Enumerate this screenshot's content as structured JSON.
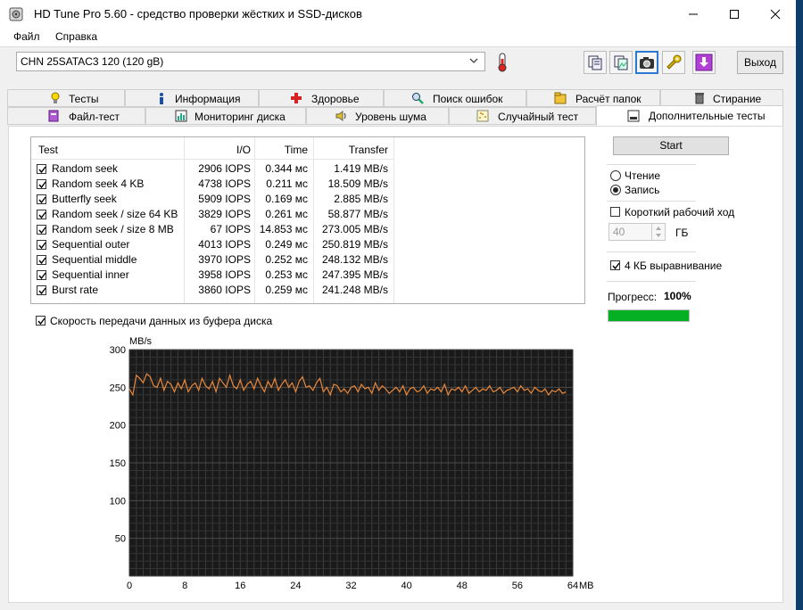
{
  "window": {
    "title": "HD Tune Pro 5.60 - средство проверки жёстких и SSD-дисков",
    "minimize_label": "—",
    "maximize_label": "☐",
    "close_label": "✕"
  },
  "menu": {
    "items": [
      "Файл",
      "Справка"
    ]
  },
  "toolbar": {
    "drive": "CHN 25SATAC3 120 (120 gB)",
    "exit_label": "Выход",
    "icons": [
      "thermometer-icon",
      "copy-text-icon",
      "copy-image-icon",
      "camera-icon",
      "tools-icon",
      "download-icon"
    ]
  },
  "tabs": {
    "row1": [
      "Тесты",
      "Информация",
      "Здоровье",
      "Поиск ошибок",
      "Расчёт папок",
      "Стирание"
    ],
    "row2": [
      "Файл-тест",
      "Мониторинг диска",
      "Уровень шума",
      "Случайный тест",
      "Дополнительные тесты"
    ],
    "active": "Дополнительные тесты"
  },
  "table": {
    "headers": {
      "test": "Test",
      "io": "I/O",
      "time": "Time",
      "transfer": "Transfer"
    },
    "rows": [
      {
        "test": "Random seek",
        "io": "2906 IOPS",
        "time": "0.344 мс",
        "transfer": "1.419 MB/s"
      },
      {
        "test": "Random seek 4 KB",
        "io": "4738 IOPS",
        "time": "0.211 мс",
        "transfer": "18.509 MB/s"
      },
      {
        "test": "Butterfly seek",
        "io": "5909 IOPS",
        "time": "0.169 мс",
        "transfer": "2.885 MB/s"
      },
      {
        "test": "Random seek  / size 64 KB",
        "io": "3829 IOPS",
        "time": "0.261 мс",
        "transfer": "58.877 MB/s"
      },
      {
        "test": "Random seek  / size 8 MB",
        "io": "67 IOPS",
        "time": "14.853 мс",
        "transfer": "273.005 MB/s"
      },
      {
        "test": "Sequential outer",
        "io": "4013 IOPS",
        "time": "0.249 мс",
        "transfer": "250.819 MB/s"
      },
      {
        "test": "Sequential middle",
        "io": "3970 IOPS",
        "time": "0.252 мс",
        "transfer": "248.132 MB/s"
      },
      {
        "test": "Sequential inner",
        "io": "3958 IOPS",
        "time": "0.253 мс",
        "transfer": "247.395 MB/s"
      },
      {
        "test": "Burst rate",
        "io": "3860 IOPS",
        "time": "0.259 мс",
        "transfer": "241.248 MB/s"
      }
    ]
  },
  "buffer_checkbox_label": "Скорость передачи данных из буфера диска",
  "side": {
    "start_label": "Start",
    "read_label": "Чтение",
    "write_label": "Запись",
    "selected_mode": "Запись",
    "short_stroke_label": "Короткий рабочий ход",
    "short_stroke_value": "40",
    "gb_label": "ГБ",
    "align_label": "4 КБ выравнивание",
    "progress_label": "Прогресс:",
    "progress_value": "100%",
    "progress_fraction": 1.0,
    "progress_color": "#06b025"
  },
  "chart_data": {
    "type": "line",
    "ylabel": "MB/s",
    "xlabel": "",
    "x_unit_label": "MB",
    "ylim": [
      0,
      300
    ],
    "xlim": [
      0,
      64
    ],
    "y_ticks": [
      50,
      100,
      150,
      200,
      250,
      300
    ],
    "x_ticks": [
      0,
      8,
      16,
      24,
      32,
      40,
      48,
      56,
      64
    ],
    "grid": true,
    "background": "#1a1a1a",
    "line_color": "#e8873a",
    "series": [
      {
        "name": "",
        "x": [
          0,
          0.5,
          1,
          1.5,
          2,
          2.5,
          3,
          3.5,
          4,
          4.5,
          5,
          5.5,
          6,
          6.5,
          7,
          7.5,
          8,
          8.5,
          9,
          9.5,
          10,
          10.5,
          11,
          11.5,
          12,
          12.5,
          13,
          13.5,
          14,
          14.5,
          15,
          15.5,
          16,
          16.5,
          17,
          17.5,
          18,
          18.5,
          19,
          19.5,
          20,
          20.5,
          21,
          21.5,
          22,
          22.5,
          23,
          23.5,
          24,
          24.5,
          25,
          25.5,
          26,
          26.5,
          27,
          27.5,
          28,
          28.5,
          29,
          29.5,
          30,
          30.5,
          31,
          31.5,
          32,
          32.5,
          33,
          33.5,
          34,
          34.5,
          35,
          35.5,
          36,
          36.5,
          37,
          37.5,
          38,
          38.5,
          39,
          39.5,
          40,
          40.5,
          41,
          41.5,
          42,
          42.5,
          43,
          43.5,
          44,
          44.5,
          45,
          45.5,
          46,
          46.5,
          47,
          47.5,
          48,
          48.5,
          49,
          49.5,
          50,
          50.5,
          51,
          51.5,
          52,
          52.5,
          53,
          53.5,
          54,
          54.5,
          55,
          55.5,
          56,
          56.5,
          57,
          57.5,
          58,
          58.5,
          59,
          59.5,
          60,
          60.5,
          61,
          61.5,
          62,
          62.5,
          63
        ],
        "values": [
          248,
          240,
          266,
          262,
          256,
          268,
          264,
          252,
          250,
          262,
          246,
          258,
          254,
          244,
          256,
          248,
          260,
          244,
          252,
          256,
          246,
          262,
          252,
          248,
          258,
          244,
          262,
          256,
          250,
          266,
          252,
          248,
          260,
          246,
          254,
          258,
          248,
          262,
          252,
          244,
          258,
          250,
          262,
          246,
          254,
          260,
          250,
          256,
          244,
          258,
          264,
          250,
          252,
          246,
          256,
          262,
          244,
          250,
          240,
          254,
          252,
          244,
          248,
          242,
          250,
          252,
          244,
          254,
          248,
          250,
          242,
          256,
          246,
          252,
          248,
          242,
          246,
          250,
          244,
          252,
          240,
          248,
          250,
          244,
          246,
          252,
          242,
          248,
          246,
          250,
          244,
          254,
          240,
          248,
          246,
          250,
          244,
          252,
          242,
          246,
          250,
          244,
          248,
          246,
          252,
          244,
          246,
          250,
          242,
          246,
          248,
          250,
          244,
          252,
          246,
          248,
          242,
          250,
          246,
          244,
          248,
          240,
          246,
          244,
          248,
          242,
          244
        ]
      }
    ]
  }
}
